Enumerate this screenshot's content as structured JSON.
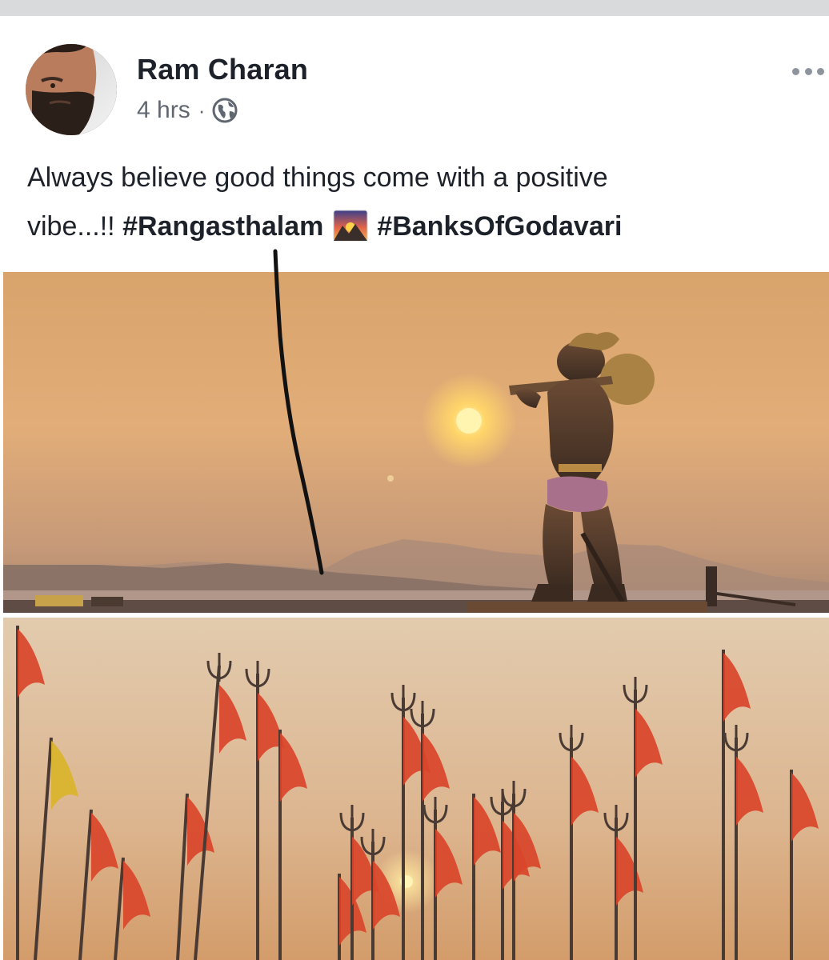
{
  "post": {
    "author": {
      "name": "Ram Charan",
      "avatar_icon": "profile-photo"
    },
    "timestamp": "4 hrs",
    "meta_separator": "·",
    "privacy_icon": "globe-icon",
    "more_icon": "more-options-icon",
    "text": {
      "line1": "Always believe good things come with a positive",
      "line2_prefix": "vibe...!!",
      "hashtag1": "#Rangasthalam",
      "emoji_icon": "sunrise-over-mountains-emoji",
      "hashtag2": "#BanksOfGodavari"
    },
    "photos": [
      {
        "icon": "sunset-hanuman-statue-photo"
      },
      {
        "icon": "flags-and-tridents-photo"
      }
    ]
  },
  "colors": {
    "text_primary": "#1d2129",
    "text_secondary": "#606770",
    "top_strip": "#d9dadc"
  }
}
